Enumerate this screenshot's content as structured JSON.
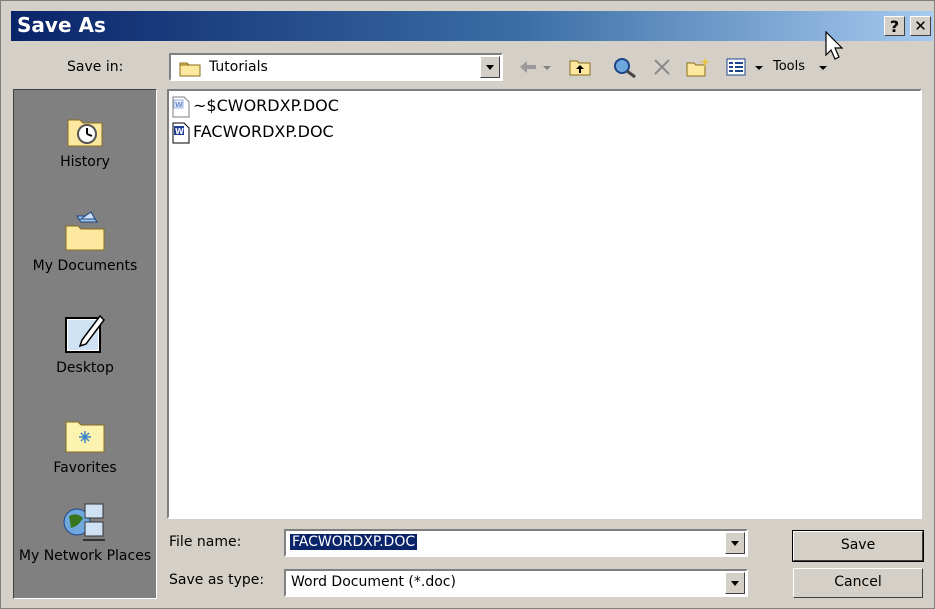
{
  "dialog": {
    "title": "Save As",
    "help_label": "?",
    "close_label": "✕"
  },
  "savein": {
    "label": "Save in:",
    "value": "Tutorials"
  },
  "toolbar": {
    "tools_label": "Tools"
  },
  "places": [
    {
      "label": "History",
      "icon": "history-icon"
    },
    {
      "label": "My Documents",
      "icon": "my-documents-icon"
    },
    {
      "label": "Desktop",
      "icon": "desktop-icon"
    },
    {
      "label": "Favorites",
      "icon": "favorites-icon"
    },
    {
      "label": "My Network Places",
      "icon": "network-places-icon"
    }
  ],
  "files": [
    {
      "name": "~$CWORDXP.DOC",
      "icon": "word-temp-doc-icon"
    },
    {
      "name": "FACWORDXP.DOC",
      "icon": "word-doc-icon"
    }
  ],
  "filename": {
    "label": "File name:",
    "value": "FACWORDXP.DOC"
  },
  "filetype": {
    "label": "Save as type:",
    "value": "Word Document (*.doc)"
  },
  "buttons": {
    "save": "Save",
    "cancel": "Cancel"
  },
  "colors": {
    "titlebar_start": "#0a246a",
    "titlebar_end": "#a6caf0",
    "face": "#d4d0c8",
    "places_bg": "#808080",
    "selection": "#0a246a"
  }
}
